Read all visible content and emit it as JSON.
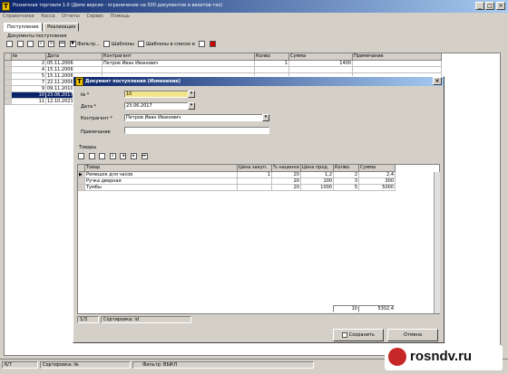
{
  "app": {
    "title": "Розничная торговля 1.0 (Демо версия - ограничение на 500 документов и визитов-тех)",
    "menu": [
      "Справочники",
      "Касса",
      "Отчеты",
      "Сервис",
      "Помощь"
    ],
    "tabs": [
      "Поступление",
      "Реализация"
    ],
    "subtitle": "Документы поступления",
    "toolbar": {
      "filter": "Фильтр...",
      "timer": "Шаблоны",
      "print_list": "Шаблоны в список в"
    },
    "main_grid": {
      "columns": [
        "№",
        "Дата",
        "Контрагент",
        "Колво",
        "Сумма",
        "Примечание"
      ],
      "rows": [
        {
          "n": "2",
          "date": "05.11.2006",
          "contractor": "Петров Иван Иванович",
          "qty": "1",
          "sum": "1400",
          "note": ""
        },
        {
          "n": "4",
          "date": "15.11.2006",
          "contractor": "",
          "qty": "",
          "sum": "",
          "note": ""
        },
        {
          "n": "5",
          "date": "15.11.2006",
          "contractor": "",
          "qty": "",
          "sum": "",
          "note": ""
        },
        {
          "n": "7",
          "date": "22.11.2006",
          "contractor": "",
          "qty": "",
          "sum": "",
          "note": ""
        },
        {
          "n": "9",
          "date": "09.11.2010",
          "contractor": "",
          "qty": "",
          "sum": "",
          "note": ""
        },
        {
          "n": "10",
          "date": "23.06.2017",
          "contractor": "",
          "qty": "",
          "sum": "",
          "note": ""
        },
        {
          "n": "11",
          "date": "12.10.2021",
          "contractor": "",
          "qty": "",
          "sum": "",
          "note": ""
        }
      ]
    },
    "status": {
      "count": "6/7",
      "sort": "Сортировка: №",
      "filter": "Фильтр: ВЫКЛ"
    }
  },
  "dialog": {
    "title": "Документ поступления (Изменение)",
    "labels": {
      "number": "№ *",
      "date": "Дата *",
      "contractor": "Контрагент *",
      "note": "Примечание"
    },
    "values": {
      "number": "10",
      "date": "23.06.2017",
      "contractor": "Петров Иван Иванович",
      "note": ""
    },
    "goods_title": "Товары",
    "goods_columns": [
      "Товар",
      "Цена закуп.",
      "% наценки",
      "Цена прод.",
      "Колво.",
      "Сумма"
    ],
    "goods_rows": [
      {
        "item": "Ремешок для часов",
        "buy": "1",
        "markup": "20",
        "sell": "1,2",
        "qty": "2",
        "sum": "2,4"
      },
      {
        "item": "Ручка дверная",
        "buy": "",
        "markup": "20",
        "sell": "100",
        "qty": "3",
        "sum": "300"
      },
      {
        "item": "Тумбы",
        "buy": "",
        "markup": "20",
        "sell": "1000",
        "qty": "5",
        "sum": "5000"
      }
    ],
    "totals": {
      "qty": "10",
      "sum": "5302,4"
    },
    "status": {
      "count": "1/3",
      "sort": "Сортировка: id"
    },
    "buttons": {
      "save": "Сохранить",
      "cancel": "Отмена"
    }
  },
  "watermark": "rosndv.ru"
}
